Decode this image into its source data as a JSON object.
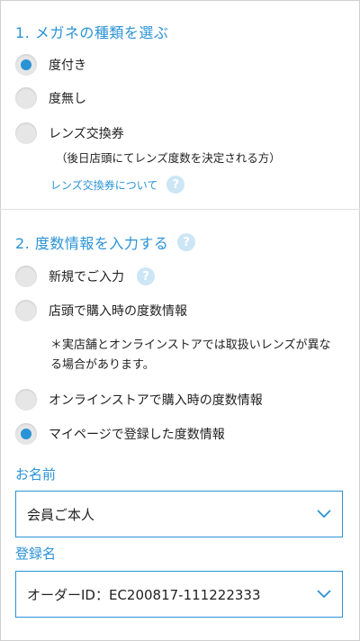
{
  "section1": {
    "title": "1. メガネの種類を選ぶ",
    "options": [
      {
        "label": "度付き",
        "checked": true
      },
      {
        "label": "度無し",
        "checked": false
      },
      {
        "label": "レンズ交換券",
        "checked": false
      }
    ],
    "lens_note": "（後日店頭にてレンズ度数を決定される方）",
    "lens_link": "レンズ交換券について"
  },
  "section2": {
    "title": "2. 度数情報を入力する",
    "options": [
      {
        "label": "新規でご入力",
        "checked": false
      },
      {
        "label": "店頭で購入時の度数情報",
        "checked": false
      },
      {
        "label": "オンラインストアで購入時の度数情報",
        "checked": false
      },
      {
        "label": "マイページで登録した度数情報",
        "checked": true
      }
    ],
    "store_warning": "＊実店舗とオンラインストアでは取扱いレンズが異なる場合があります。"
  },
  "form": {
    "name_label": "お名前",
    "name_value": "会員ご本人",
    "reg_label": "登録名",
    "reg_value": "オーダーID：EC200817-111222333"
  },
  "icons": {
    "help": "?"
  },
  "colors": {
    "accent": "#2a93d5",
    "help_bg": "#cde6f5",
    "radio_bg": "#e6e6e6"
  }
}
